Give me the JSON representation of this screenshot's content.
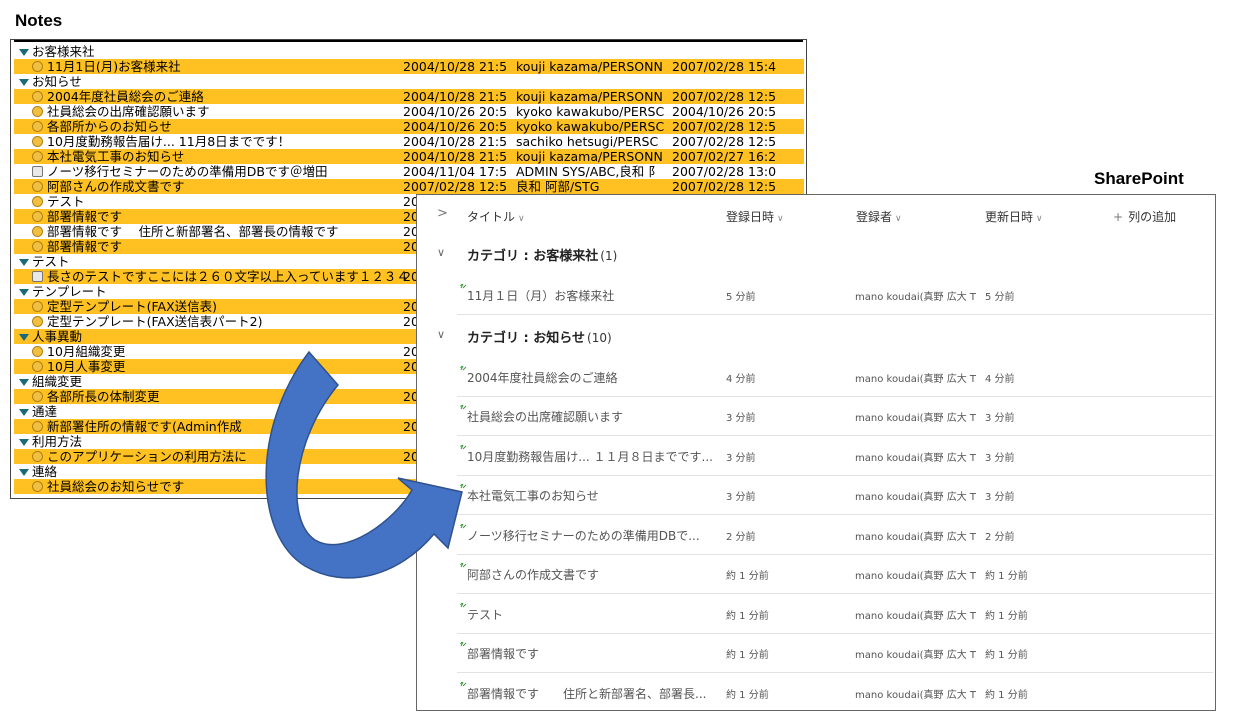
{
  "labels": {
    "notes": "Notes",
    "sharepoint": "SharePoint"
  },
  "notes": {
    "rows": [
      {
        "type": "cat",
        "label": "お客様来社",
        "hl": false
      },
      {
        "type": "doc",
        "icon": "smiley",
        "title": "11月1日(月)お客様来社",
        "date": "2004/10/28 21:5",
        "author": "kouji kazama/PERSONN",
        "updated": "2007/02/28 15:4",
        "hl": true
      },
      {
        "type": "cat",
        "label": "お知らせ",
        "hl": false
      },
      {
        "type": "doc",
        "icon": "smiley",
        "title": "2004年度社員総会のご連絡",
        "date": "2004/10/28 21:5",
        "author": "kouji kazama/PERSONN",
        "updated": "2007/02/28 12:5",
        "hl": true
      },
      {
        "type": "doc",
        "icon": "smiley",
        "title": "社員総会の出席確認願います",
        "date": "2004/10/26 20:5",
        "author": "kyoko kawakubo/PERSC",
        "updated": "2004/10/26 20:5",
        "hl": false
      },
      {
        "type": "doc",
        "icon": "smiley",
        "title": "各部所からのお知らせ",
        "date": "2004/10/26 20:5",
        "author": "kyoko kawakubo/PERSC",
        "updated": "2007/02/28 12:5",
        "hl": true
      },
      {
        "type": "doc",
        "icon": "smiley",
        "title": "10月度勤務報告届け... 11月8日までです！",
        "date": "2004/10/28 21:5",
        "author": "sachiko hetsugi/PERSC",
        "updated": "2007/02/28 12:5",
        "hl": false
      },
      {
        "type": "doc",
        "icon": "smiley",
        "title": "本社電気工事のお知らせ",
        "date": "2004/10/28 21:5",
        "author": "kouji kazama/PERSONN",
        "updated": "2007/02/27 16:2",
        "hl": true
      },
      {
        "type": "doc",
        "icon": "bubble",
        "title": "ノーツ移行セミナーのための準備用DBです＠増田",
        "date": "2004/11/04 17:5",
        "author": "ADMIN SYS/ABC,良和 阝",
        "updated": "2007/02/28 13:0",
        "hl": false
      },
      {
        "type": "doc",
        "icon": "smiley",
        "title": "阿部さんの作成文書です",
        "date": "2007/02/28 12:5",
        "author": "良和 阿部/STG",
        "updated": "2007/02/28 12:5",
        "hl": true
      },
      {
        "type": "doc",
        "icon": "smiley",
        "title": "テスト",
        "date": "20",
        "author": "",
        "updated": "",
        "hl": false
      },
      {
        "type": "doc",
        "icon": "smiley",
        "title": "部署情報です",
        "date": "20",
        "author": "",
        "updated": "",
        "hl": true
      },
      {
        "type": "doc",
        "icon": "smiley",
        "title": "部署情報です　 住所と新部署名、部署長の情報です",
        "date": "20",
        "author": "",
        "updated": "",
        "hl": false
      },
      {
        "type": "doc",
        "icon": "smiley",
        "title": "部署情報です",
        "date": "20",
        "author": "",
        "updated": "",
        "hl": true
      },
      {
        "type": "cat",
        "label": "テスト",
        "hl": false
      },
      {
        "type": "doc",
        "icon": "bubble",
        "title": "長さのテストですここには２６０文字以上入っています１２３４",
        "date": "20",
        "author": "",
        "updated": "",
        "hl": true
      },
      {
        "type": "cat",
        "label": "テンプレート",
        "hl": false
      },
      {
        "type": "doc",
        "icon": "smiley",
        "title": "定型テンプレート(FAX送信表)",
        "date": "20",
        "author": "",
        "updated": "",
        "hl": true
      },
      {
        "type": "doc",
        "icon": "smiley",
        "title": "定型テンプレート(FAX送信表パート2)",
        "date": "20",
        "author": "",
        "updated": "",
        "hl": false
      },
      {
        "type": "cat",
        "label": "人事異動",
        "hl": true
      },
      {
        "type": "doc",
        "icon": "smiley",
        "title": "10月組織変更",
        "date": "20",
        "author": "",
        "updated": "",
        "hl": false
      },
      {
        "type": "doc",
        "icon": "smiley",
        "title": "10月人事変更",
        "date": "20",
        "author": "",
        "updated": "",
        "hl": true
      },
      {
        "type": "cat",
        "label": "組織変更",
        "hl": false
      },
      {
        "type": "doc",
        "icon": "smiley",
        "title": "各部所長の体制変更",
        "date": "20",
        "author": "",
        "updated": "",
        "hl": true
      },
      {
        "type": "cat",
        "label": "通達",
        "hl": false
      },
      {
        "type": "doc",
        "icon": "smiley",
        "title": "新部署住所の情報です(Admin作成",
        "date": "20",
        "author": "",
        "updated": "",
        "hl": true
      },
      {
        "type": "cat",
        "label": "利用方法",
        "hl": false
      },
      {
        "type": "doc",
        "icon": "smiley",
        "title": "このアプリケーションの利用方法に",
        "date": "20",
        "author": "",
        "updated": "",
        "hl": true
      },
      {
        "type": "cat",
        "label": "連絡",
        "hl": false
      },
      {
        "type": "doc",
        "icon": "smiley",
        "title": "社員総会のお知らせです",
        "date": "",
        "author": "",
        "updated": "",
        "hl": true
      }
    ]
  },
  "sharepoint": {
    "header": {
      "title": "タイトル",
      "created": "登録日時",
      "author": "登録者",
      "modified": "更新日時",
      "add_column": "列の追加",
      "plus": "+",
      "chevron": "∨",
      "expand": ">"
    },
    "groups": [
      {
        "prefix": "カテゴリ : ",
        "name": "お客様来社",
        "count": "(1)",
        "chevron": "∨",
        "items": [
          {
            "title": "11月１日（月）お客様来社",
            "created": "5 分前",
            "author": "mano koudai(真野 広大 TI",
            "modified": "5 分前"
          }
        ]
      },
      {
        "prefix": "カテゴリ : ",
        "name": "お知らせ",
        "count": "(10)",
        "chevron": "∨",
        "items": [
          {
            "title": "2004年度社員総会のご連絡",
            "created": "4 分前",
            "author": "mano koudai(真野 広大 TI",
            "modified": "4 分前"
          },
          {
            "title": "社員総会の出席確認願います",
            "created": "3 分前",
            "author": "mano koudai(真野 広大 TI",
            "modified": "3 分前"
          },
          {
            "title": "10月度勤務報告届け... １１月８日までです...",
            "created": "3 分前",
            "author": "mano koudai(真野 広大 TI",
            "modified": "3 分前"
          },
          {
            "title": "本社電気工事のお知らせ",
            "created": "3 分前",
            "author": "mano koudai(真野 広大 TI",
            "modified": "3 分前"
          },
          {
            "title": "ノーツ移行セミナーのための準備用DBで...",
            "created": "2 分前",
            "author": "mano koudai(真野 広大 TI",
            "modified": "2 分前"
          },
          {
            "title": "阿部さんの作成文書です",
            "created": "約 1 分前",
            "author": "mano koudai(真野 広大 TI",
            "modified": "約 1 分前"
          },
          {
            "title": "テスト",
            "created": "約 1 分前",
            "author": "mano koudai(真野 広大 TI",
            "modified": "約 1 分前"
          },
          {
            "title": "部署情報です",
            "created": "約 1 分前",
            "author": "mano koudai(真野 広大 TI",
            "modified": "約 1 分前"
          },
          {
            "title": "部署情報です　　住所と新部署名、部署長...",
            "created": "約 1 分前",
            "author": "mano koudai(真野 広大 TI",
            "modified": "約 1 分前"
          }
        ]
      }
    ]
  },
  "colors": {
    "highlight": "#ffc021",
    "arrow": "#4472c4",
    "arrow_edge": "#2f528f",
    "triangle": "#1a6a7a"
  }
}
